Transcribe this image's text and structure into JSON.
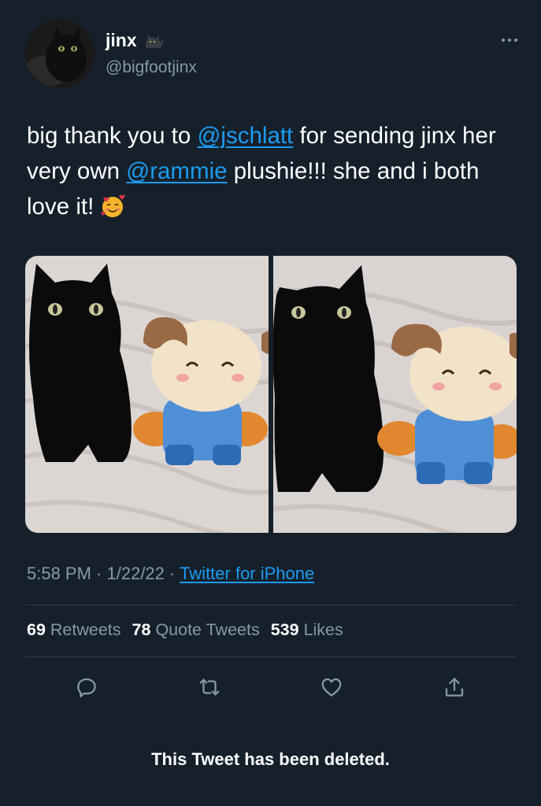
{
  "author": {
    "display_name": "jinx",
    "name_emoji": "black-cat-emoji",
    "handle": "@bigfootjinx"
  },
  "tweet": {
    "text_part1": "big thank you to ",
    "mention1": "@jschlatt",
    "text_part2": " for sending jinx her very own ",
    "mention2": "@rammie",
    "text_part3": " plushie!!! she and i both love it! ",
    "end_emoji": "smiling-face-with-hearts-emoji"
  },
  "media": {
    "photos": [
      {
        "alt": "black cat sitting beside ram plushie"
      },
      {
        "alt": "black cat sitting beside ram plushie"
      }
    ]
  },
  "meta": {
    "time": "5:58 PM",
    "separator": " · ",
    "date": "1/22/22",
    "source": "Twitter for iPhone"
  },
  "stats": {
    "retweets_count": "69",
    "retweets_label": "Retweets",
    "quotes_count": "78",
    "quotes_label": "Quote Tweets",
    "likes_count": "539",
    "likes_label": "Likes"
  },
  "actions": [
    "reply-icon",
    "retweet-icon",
    "like-icon",
    "share-icon"
  ],
  "notice": "This Tweet has been deleted.",
  "colors": {
    "background": "#15202b",
    "accent": "#1d9bf0",
    "secondary_text": "#8b98a5",
    "divider": "#2f3b47"
  }
}
